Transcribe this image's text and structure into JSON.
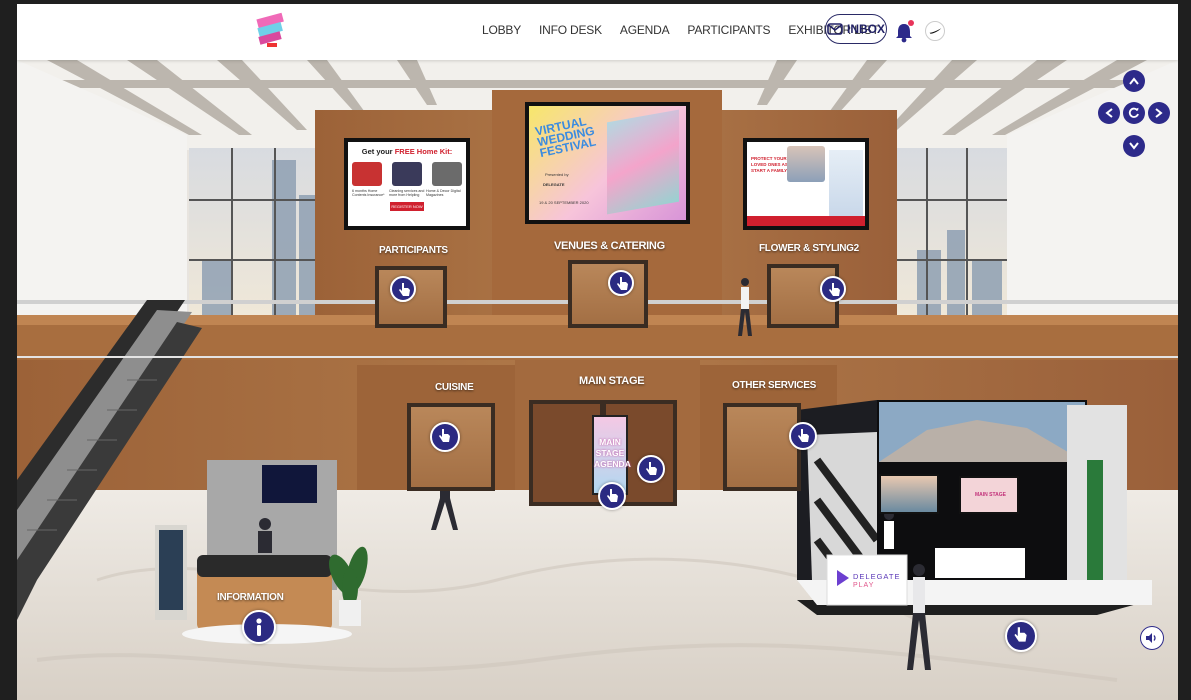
{
  "nav": {
    "items": [
      "LOBBY",
      "INFO DESK",
      "AGENDA",
      "PARTICIPANTS",
      "EXHIBITOR LIST"
    ],
    "inbox_label": "INBOX"
  },
  "scene": {
    "upper_signs": {
      "participants": "PARTICIPANTS",
      "venues": "VENUES & CATERING",
      "flower": "FLOWER & STYLING2"
    },
    "lower_signs": {
      "cuisine": "CUISINE",
      "main_stage": "MAIN STAGE",
      "other_services": "OTHER SERVICES"
    },
    "left_screen": {
      "headline_pre": "Get your",
      "headline_free": "FREE Home Kit:",
      "items": [
        "6 months Home Contents Insurance*",
        "Cleaning services and more from Helpling",
        "Home & Decor Digital Magazines"
      ],
      "button": "REGISTER NOW"
    },
    "center_screen": {
      "title": "VIRTUAL WEDDING FESTIVAL",
      "dates": "19 & 20 SEPTEMBER 2020",
      "presented_by": "Presented by",
      "partner": "DELEGATE"
    },
    "right_screen": {
      "headline": "PROTECT YOUR LOVED ONES AS YOU START A FAMILY"
    },
    "main_stage_poster": "MAIN STAGE AGENDA",
    "info_desk_label": "INFORMATION",
    "booth": {
      "brand": "DELEGATE",
      "brand_sub": "PLAY",
      "screen_label": "MAIN STAGE"
    }
  },
  "colors": {
    "accent": "#2d2a8a",
    "wood": "#a86e3f",
    "floor": "#e6e0d8"
  }
}
